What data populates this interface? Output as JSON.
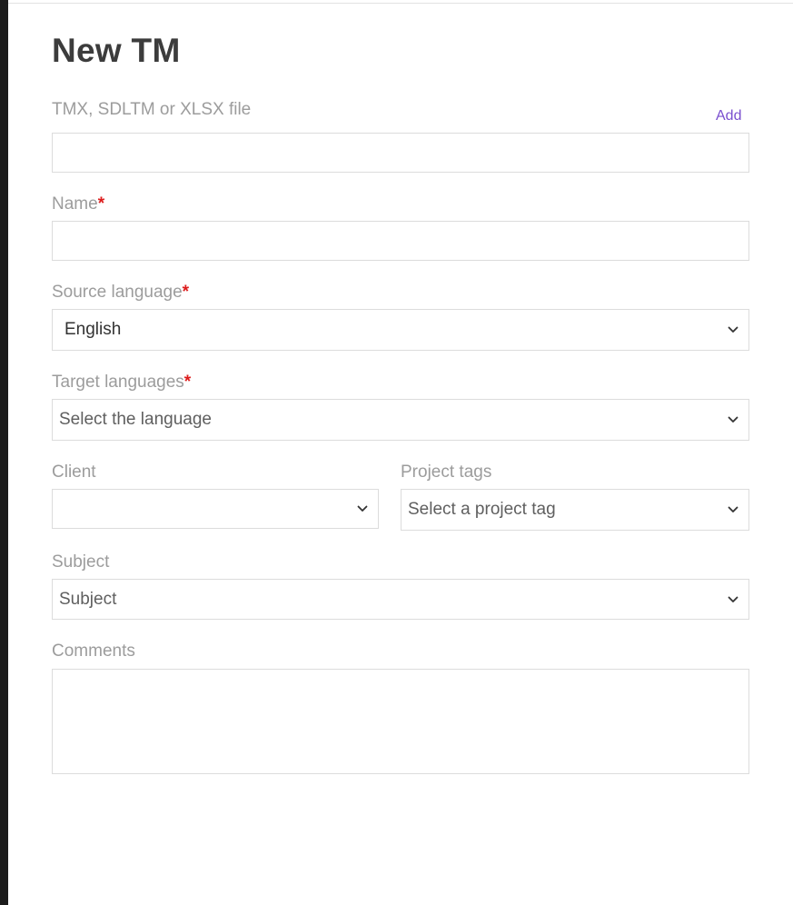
{
  "form": {
    "title": "New TM",
    "file": {
      "label": "TMX, SDLTM or XLSX file",
      "add_label": "Add",
      "value": ""
    },
    "name": {
      "label": "Name",
      "required_mark": "*",
      "value": ""
    },
    "source_language": {
      "label": "Source language",
      "required_mark": "*",
      "value": "English"
    },
    "target_languages": {
      "label": "Target languages",
      "required_mark": "*",
      "placeholder": "Select the language"
    },
    "client": {
      "label": "Client",
      "value": ""
    },
    "project_tags": {
      "label": "Project tags",
      "placeholder": "Select a project tag"
    },
    "subject": {
      "label": "Subject",
      "placeholder": "Subject"
    },
    "comments": {
      "label": "Comments",
      "value": ""
    }
  },
  "icons": {
    "dropdown": "chevron-down-icon"
  }
}
